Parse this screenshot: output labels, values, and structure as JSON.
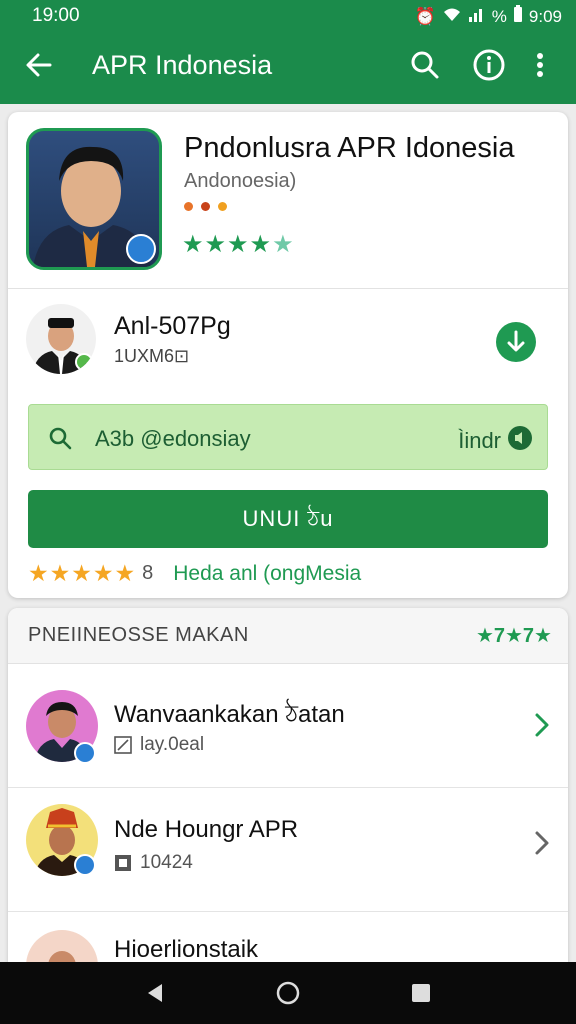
{
  "status_bar": {
    "time": "19:00",
    "right_time": "9:09"
  },
  "app_bar": {
    "title": "APR Indonesia"
  },
  "app": {
    "name": "Pndonlusra APR Idonesia",
    "developer": "Andonoesia)",
    "rating_stars": 4,
    "dot_colors": [
      "#e8742a",
      "#c8431a",
      "#f0a020"
    ]
  },
  "uploader": {
    "name": "Anl-507Pg",
    "subtitle": "1UXM6⊡"
  },
  "search": {
    "query": "A3b @edonsiay",
    "right_label": "Ìindr"
  },
  "install_label": "UNUI ঠu",
  "rating_row": {
    "stars": "★★★★★",
    "count": "8",
    "link": "Heda anl (ongMesia"
  },
  "section": {
    "title": "PNEIINEOSSE MAKAN",
    "badge": "★7★7★"
  },
  "rows": [
    {
      "name": "Wanvaankakan ঠatan",
      "sub": "lay.0eal"
    },
    {
      "name": "Nde Houngr APR",
      "sub": "10424"
    },
    {
      "name": "Hioerlionstaik",
      "sub": ""
    }
  ],
  "colors": {
    "primary": "#1b8b4b",
    "accent_star": "#f5a623",
    "search_bg": "#c6ebb3"
  }
}
